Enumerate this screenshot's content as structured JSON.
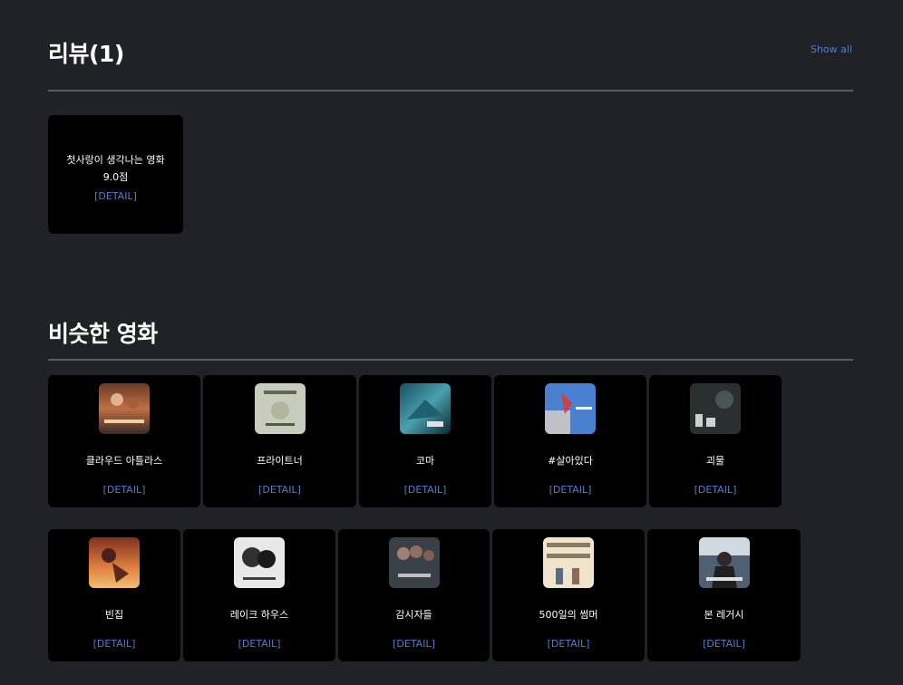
{
  "reviews": {
    "heading": "리뷰(1)",
    "show_all": "Show all",
    "items": [
      {
        "title": "첫사랑이 생각나는 영화",
        "score": "9.0점",
        "detail": "[DETAIL]"
      }
    ]
  },
  "similar": {
    "heading": "비슷한 영화",
    "movies": [
      {
        "title": "클라우드 아틀라스",
        "detail": "[DETAIL]",
        "poster_icon": "movie-poster"
      },
      {
        "title": "프라이트너",
        "detail": "[DETAIL]",
        "poster_icon": "movie-poster"
      },
      {
        "title": "코마",
        "detail": "[DETAIL]",
        "poster_icon": "movie-poster"
      },
      {
        "title": "#살아있다",
        "detail": "[DETAIL]",
        "poster_icon": "movie-poster"
      },
      {
        "title": "괴물",
        "detail": "[DETAIL]",
        "poster_icon": "movie-poster"
      },
      {
        "title": "빈집",
        "detail": "[DETAIL]",
        "poster_icon": "movie-poster"
      },
      {
        "title": "레이크 하우스",
        "detail": "[DETAIL]",
        "poster_icon": "movie-poster"
      },
      {
        "title": "감시자들",
        "detail": "[DETAIL]",
        "poster_icon": "movie-poster"
      },
      {
        "title": "500일의 썸머",
        "detail": "[DETAIL]",
        "poster_icon": "movie-poster"
      },
      {
        "title": "본 레거시",
        "detail": "[DETAIL]",
        "poster_icon": "movie-poster"
      }
    ]
  },
  "colors": {
    "background": "#202227",
    "card": "#000000",
    "link": "#4f7fd0",
    "divider": "#5a5d63"
  }
}
